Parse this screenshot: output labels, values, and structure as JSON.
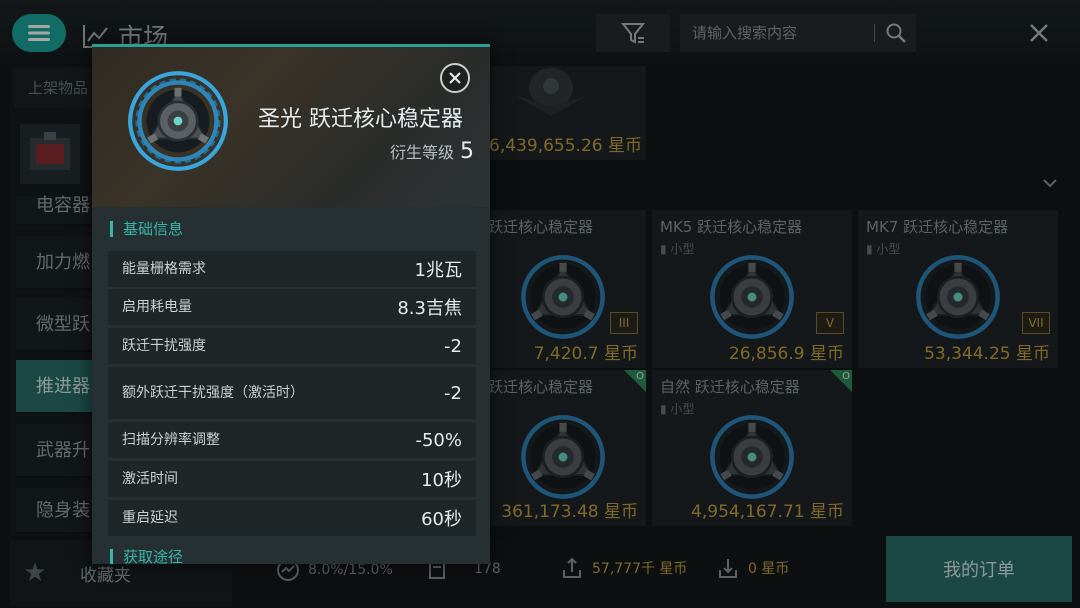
{
  "topbar": {
    "title": "市场",
    "search_placeholder": "请输入搜索内容"
  },
  "sidebar": {
    "tab_label": "上架物品",
    "categories": [
      {
        "label": "电容器"
      },
      {
        "label": "加力燃"
      },
      {
        "label": "微型跃"
      },
      {
        "label": "推进器"
      },
      {
        "label": "武器升"
      },
      {
        "label": "隐身装"
      }
    ]
  },
  "top_card": {
    "price": "6,439,655.26 星币"
  },
  "grid": {
    "cards": [
      {
        "name": "跃迁核心稳定器",
        "size": "",
        "tier": "III",
        "price": "7,420.7 星币"
      },
      {
        "name": "MK5 跃迁核心稳定器",
        "size": "小型",
        "tier": "V",
        "price": "26,856.9 星币"
      },
      {
        "name": "MK7 跃迁核心稳定器",
        "size": "小型",
        "tier": "VII",
        "price": "53,344.25 星币"
      },
      {
        "name": "跃迁核心稳定器",
        "size": "",
        "tier": "",
        "price": "361,173.48 星币",
        "badge": "O"
      },
      {
        "name": "自然 跃迁核心稳定器",
        "size": "小型",
        "tier": "",
        "price": "4,954,167.71 星币",
        "badge": "O"
      }
    ]
  },
  "bottombar": {
    "favorites_label": "收藏夹",
    "tax_rate": "8.0%/15.0%",
    "order_count": "178",
    "sell_total": "57,777千 星币",
    "buy_total": "0 星币",
    "my_orders_label": "我的订单"
  },
  "popup": {
    "title": "圣光 跃迁核心稳定器",
    "level_label": "衍生等级",
    "level_value": "5",
    "section_basic": "基础信息",
    "section_source": "获取途径",
    "attributes": [
      {
        "name": "能量栅格需求",
        "value": "1兆瓦"
      },
      {
        "name": "启用耗电量",
        "value": "8.3吉焦"
      },
      {
        "name": "跃迁干扰强度",
        "value": "-2"
      },
      {
        "name": "额外跃迁干扰强度（激活时）",
        "value": "-2"
      },
      {
        "name": "扫描分辨率调整",
        "value": "-50%"
      },
      {
        "name": "激活时间",
        "value": "10秒"
      },
      {
        "name": "重启延迟",
        "value": "60秒"
      }
    ]
  },
  "colors": {
    "accent": "#2a9f93",
    "active_category": "#2a6e69",
    "price": "#c7a33f",
    "icon_ring": "#3aa6de"
  }
}
